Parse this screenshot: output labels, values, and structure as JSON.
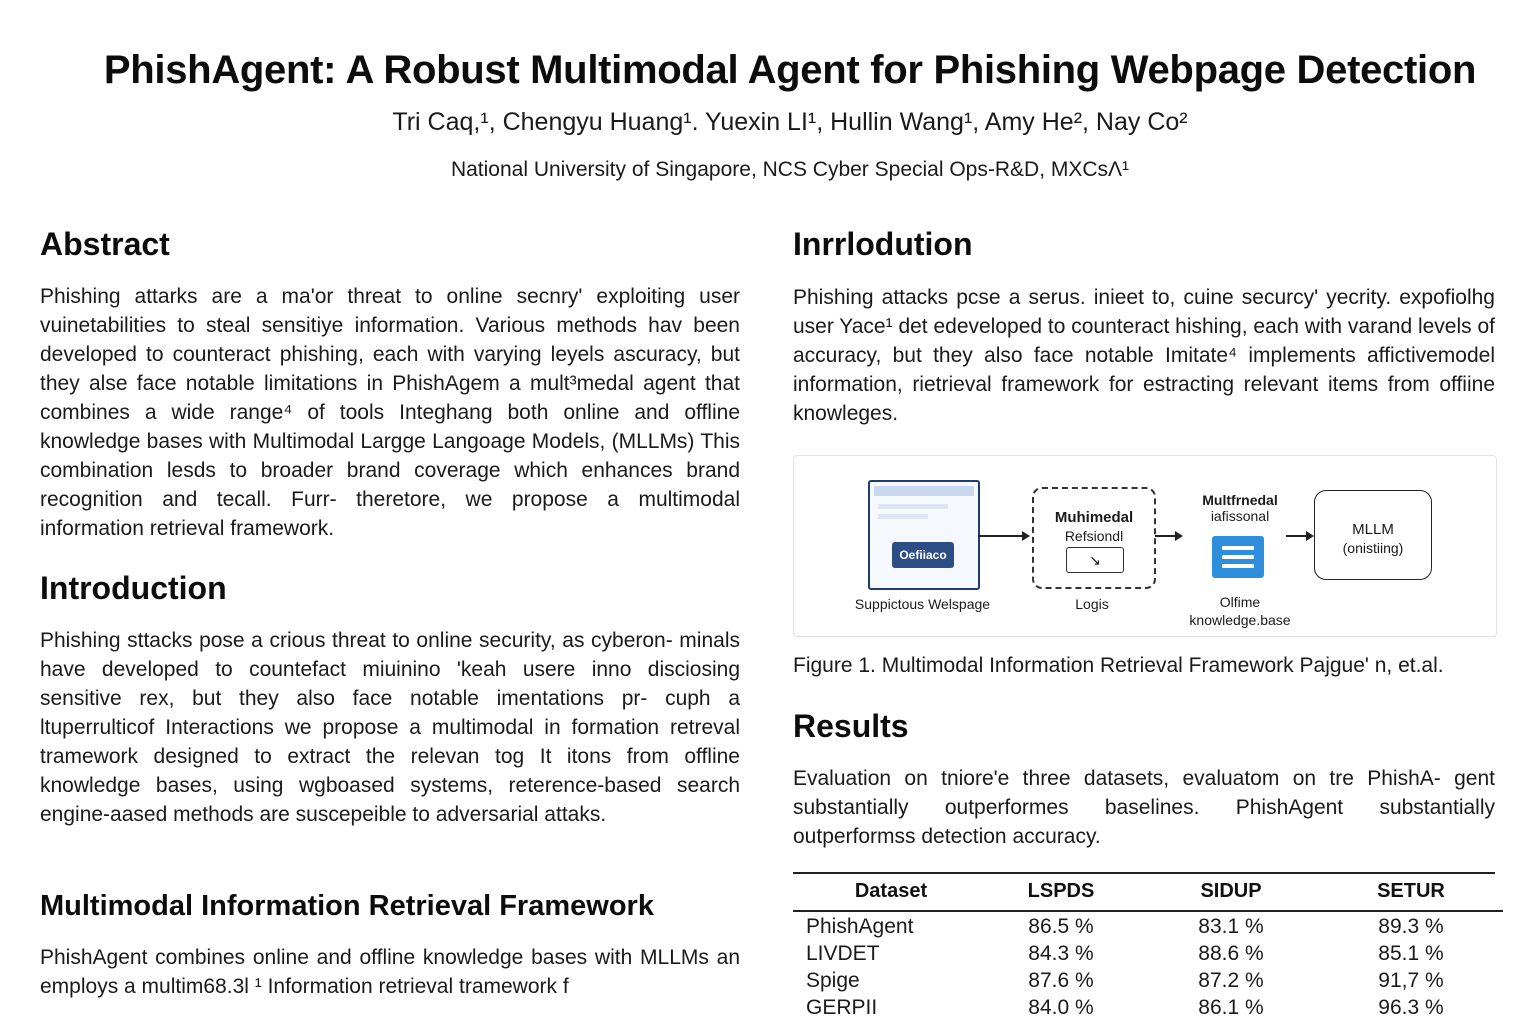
{
  "paper": {
    "title": "PhishAgent: A Robust Multimodal Agent for Phishing Webpage Detection",
    "authors": "Tri Caq,¹, Chengyu Huang¹. Yuexin LI¹, Hullin Wang¹, Amy He², Nay Co²",
    "affiliation": "National University of Singapore, NCS Cyber Special Ops-R&D, MXCsΛ¹"
  },
  "left": {
    "abstract_heading": "Abstract",
    "abstract_text": "Phishing attarks are a ma'or threat to online secnry' exploiting user vuinetabilities to steal sensitiye information. Various methods hav been developed to counteract phishing, each with varying leyels ascuracy, but they alse face notable limitations in PhishAgem a mult³medal agent that combines a wide range⁴ of tools Integhang both online and offline knowledge bases with Multimodal Largge Langoage Models, (MLLMs) This combination lesds to broader brand coverage which enhances brand recognition and tecall. Furr- theretore, we propose a multimodal information retrieval framework.",
    "intro_heading": "Introduction",
    "intro_text": "Phishing sttacks pose a crious threat to online security, as cyberon- minals have developed to countefact miuinino 'keah usere inno disciosing sensitive rex, but they also face notable imentations pr- cuph a ltuperrulticof Interactions we propose a multimodal in formation retreval tramework designed to extract the relevan tog It itons from offline knowledge bases, using wgboased systems, reterence-based search engine-aased methods are suscepeible to adversarial attaks.",
    "mirf_heading": "Multimodal Information Retrieval Framework",
    "mirf_text": "PhishAgent combines online and offline knowledge bases with MLLMs an employs a multim68.3l ¹ Information retrieval tramework f"
  },
  "right": {
    "intro_heading": "Inrrlodution",
    "intro_text": "Phishing attacks pcse a serus. inieet to, cuine securcy' yecrity. expofiolhg user Yace¹ det edeveloped to counteract hishing, each with varand levels of accuracy, but they also face notable Imitate⁴ implements affictivemodel information, rietrieval framework for estracting relevant items from offiine knowleges.",
    "results_heading": "Results",
    "results_text": "Evaluation on tniore'e three datasets, evaluatom on tre PhishA- gent substantially outperformes baselines. PhishAgent substantially outperformss detection accuracy."
  },
  "figure": {
    "webpage_button": "Oefiiaco",
    "webpage_label": "Suppictous Welspage",
    "node2_title": "Muhimedal",
    "node2_sub": "Refsiondl",
    "node2_inner": "↘",
    "node2_label": "Logis",
    "node3_title": "Multfrnedal",
    "node3_sub": "iafissonal",
    "node3_label_1": "Olfime",
    "node3_label_2": "knowledge.base",
    "node4_title": "MLLM",
    "node4_sub": "(onistiing)",
    "caption": "Figure 1. Multimodal Information Retrieval Framework Pajgue' n, et.al."
  },
  "table": {
    "headers": [
      "Dataset",
      "LSPDS",
      "SIDUP",
      "SETUR"
    ],
    "rows": [
      [
        "PhishAgent",
        "86.5 %",
        "83.1 %",
        "89.3 %"
      ],
      [
        "LIVDET",
        "84.3 %",
        "88.6 %",
        "85.1 %"
      ],
      [
        "Spige",
        "87.6 %",
        "87.2 %",
        "91,7 %"
      ],
      [
        "GERPII",
        "84.0 %",
        "86.1 %",
        "96.3 %"
      ]
    ]
  }
}
